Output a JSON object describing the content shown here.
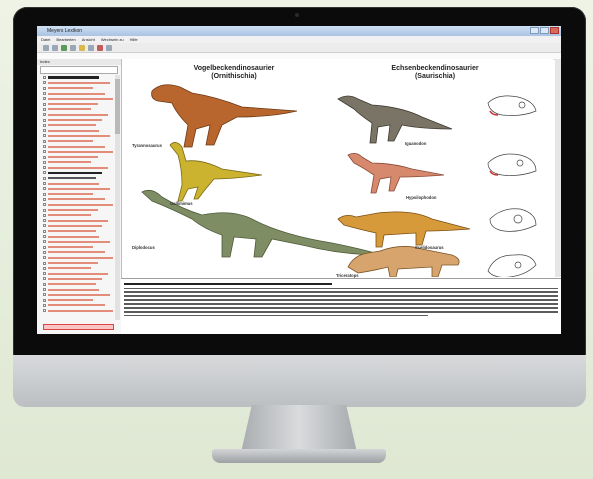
{
  "window": {
    "title": "Meyers Lexikon",
    "menu": [
      "Datei",
      "Bearbeiten",
      "Ansicht",
      "Wechseln zu",
      "Hilfe"
    ]
  },
  "sidebar": {
    "header": "Index",
    "section_label": "Dinosaurier",
    "rows": [
      {
        "k": "hdr"
      },
      {
        "k": "r"
      },
      {
        "k": "r"
      },
      {
        "k": "r"
      },
      {
        "k": "r"
      },
      {
        "k": "r"
      },
      {
        "k": "r"
      },
      {
        "k": "r"
      },
      {
        "k": "r"
      },
      {
        "k": "r"
      },
      {
        "k": "r"
      },
      {
        "k": "r"
      },
      {
        "k": "r"
      },
      {
        "k": "r"
      },
      {
        "k": "r"
      },
      {
        "k": "r"
      },
      {
        "k": "r"
      },
      {
        "k": "r"
      },
      {
        "k": "hdr"
      },
      {
        "k": "dark"
      },
      {
        "k": "r"
      },
      {
        "k": "r"
      },
      {
        "k": "r"
      },
      {
        "k": "r"
      },
      {
        "k": "r"
      },
      {
        "k": "r"
      },
      {
        "k": "r"
      },
      {
        "k": "r"
      },
      {
        "k": "r"
      },
      {
        "k": "r"
      },
      {
        "k": "r"
      },
      {
        "k": "r"
      },
      {
        "k": "r"
      },
      {
        "k": "r"
      },
      {
        "k": "r"
      },
      {
        "k": "r"
      },
      {
        "k": "r"
      },
      {
        "k": "r"
      },
      {
        "k": "r"
      },
      {
        "k": "r"
      },
      {
        "k": "r"
      },
      {
        "k": "r"
      },
      {
        "k": "r"
      },
      {
        "k": "r"
      },
      {
        "k": "r"
      }
    ]
  },
  "plate": {
    "left_title_1": "Vogelbeckendinosaurier",
    "left_title_2": "(Ornithischia)",
    "right_title_1": "Echsenbeckendinosaurier",
    "right_title_2": "(Saurischia)",
    "dinosaurs": {
      "tyrannosaurus": "Tyrannosaurus",
      "gallimimus": "Gallimimus",
      "diplodocus": "Diplodocus",
      "iguanodon": "Iguanodon",
      "hypsilophodon": "Hypsilophodon",
      "scelidosaurus": "Scelidosaurus",
      "triceratops": "Triceratops"
    }
  },
  "colors": {
    "accent": "#e48c7a",
    "window_chrome": "#a9c3e3"
  }
}
